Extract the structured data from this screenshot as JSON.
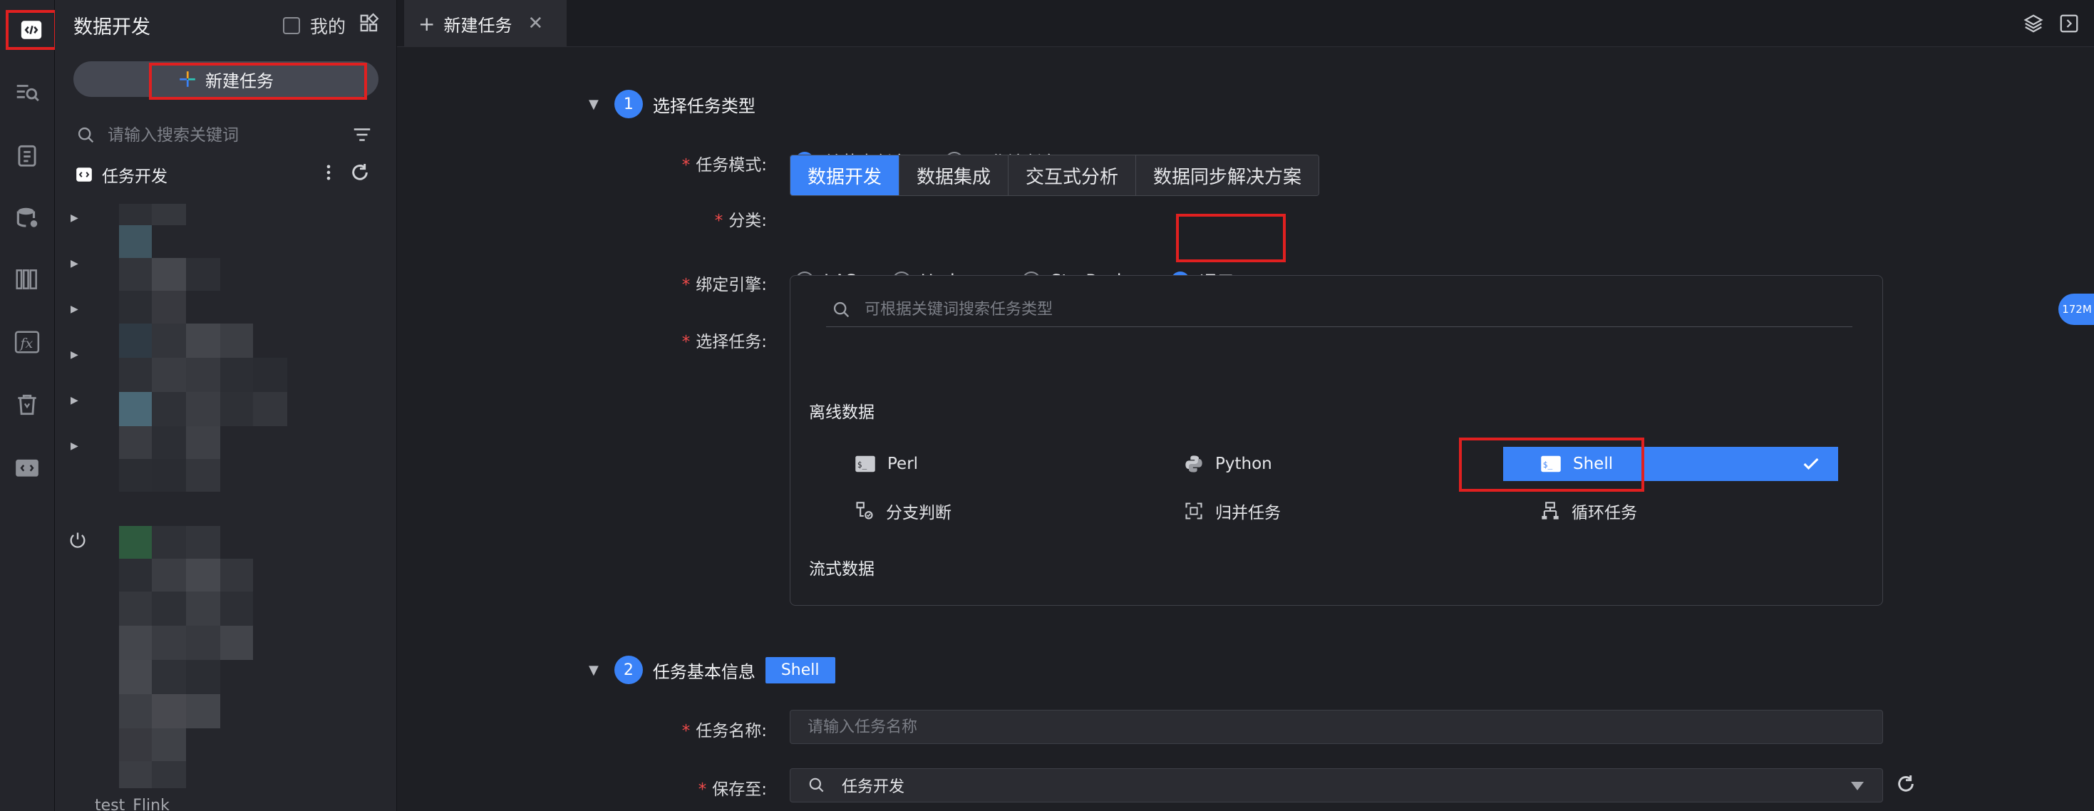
{
  "sidebar": {
    "title": "数据开发",
    "mine_label": "我的",
    "new_task_label": "新建任务",
    "search_placeholder": "请输入搜索关键词",
    "tree_root_label": "任务开发",
    "bottom_item_label": "test_Flink"
  },
  "tab": {
    "label": "新建任务"
  },
  "section1": {
    "step": "1",
    "title": "选择任务类型",
    "mode_label": "任务模式:",
    "mode_options": [
      "单节点任务",
      "工作流任务"
    ],
    "mode_selected": "单节点任务",
    "category_label": "分类:",
    "categories": [
      "数据开发",
      "数据集成",
      "交互式分析",
      "数据同步解决方案"
    ],
    "category_selected": "数据开发",
    "engine_label": "绑定引擎:",
    "engines": [
      "LAS",
      "Hadoop",
      "StarRocks",
      "通用"
    ],
    "engine_selected": "通用",
    "task_label": "选择任务:",
    "task_search_placeholder": "可根据关键词搜索任务类型",
    "offline_title": "离线数据",
    "offline_items": [
      "Perl",
      "Python",
      "Shell",
      "分支判断",
      "归并任务",
      "循环任务"
    ],
    "selected_item": "Shell",
    "stream_title": "流式数据"
  },
  "section2": {
    "step": "2",
    "title": "任务基本信息",
    "badge": "Shell",
    "name_label": "任务名称:",
    "name_placeholder": "请输入任务名称",
    "save_label": "保存至:",
    "save_value": "任务开发"
  },
  "memory_badge": "172M",
  "colors": {
    "accent": "#3a82f7",
    "highlight": "#e02020",
    "required": "#f04b4b"
  }
}
